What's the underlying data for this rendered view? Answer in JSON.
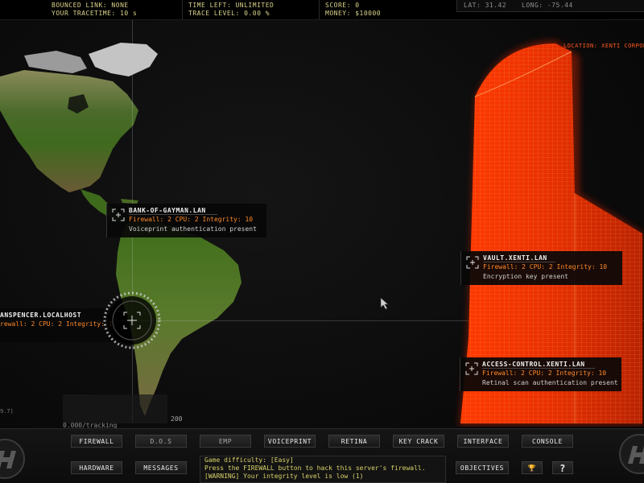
{
  "status": {
    "bounced_link": "BOUNCED LINK: NONE",
    "tracetime": "YOUR TRACETIME: 10 s",
    "time_left": "TIME LEFT: UNLIMITED",
    "trace_level": "TRACE LEVEL: 0.00 %",
    "score": "SCORE: 0",
    "money": "MONEY: $10000",
    "lat": "LAT: 31.42",
    "long": "LONG: -75.44"
  },
  "location": "LOCATION: XENTI CORPORA",
  "nodes": [
    {
      "name": "BANK-OF-GAYMAN.LAN",
      "stats": "Firewall: 2 CPU: 2 Integrity: 10",
      "desc": "Voiceprint authentication present"
    },
    {
      "name": "VAULT.XENTI.LAN",
      "stats": "Firewall: 2 CPU: 2 Integrity: 10",
      "desc": "Encryption key present"
    },
    {
      "name": "ACCESS-CONTROL.XENTI.LAN",
      "stats": "Firewall: 2 CPU: 2 Integrity: 10",
      "desc": "Retinal scan authentication present"
    },
    {
      "name": "ANSPENCER.LOCALHOST",
      "stats": "rewall: 2 CPU: 2 Integrity: 1",
      "desc": ""
    }
  ],
  "tracking": {
    "label": "0.000/tracking",
    "scale_left": "9.7)",
    "scale_right": "200"
  },
  "buttons_row1": [
    "FIREWALL",
    "D.O.S",
    "EMP",
    "VOICEPRINT",
    "RETINA",
    "KEY CRACK",
    "INTERFACE",
    "CONSOLE"
  ],
  "buttons_row2": {
    "hardware": "HARDWARE",
    "messages": "MESSAGES",
    "objectives": "OBJECTIVES",
    "trophy": "🏆",
    "help": "?"
  },
  "messages": [
    "Game difficulty: [Easy]",
    "Press the FIREWALL button to hack this server's firewall.",
    "[WARNING] Your integrity level is low (1)"
  ],
  "colors": {
    "accent": "#ff5a1f",
    "status_text": "#d9d38a",
    "node_stats": "#ff8a2a",
    "message_text": "#d9d36a"
  }
}
